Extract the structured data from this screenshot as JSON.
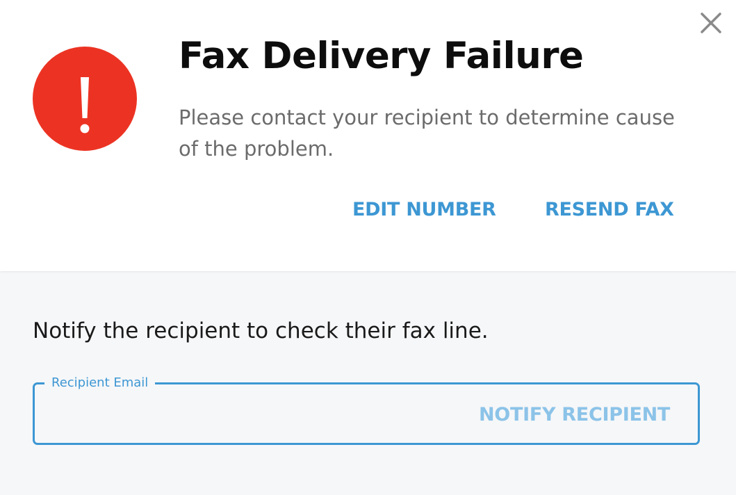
{
  "dialog": {
    "title": "Fax Delivery Failure",
    "message": "Please contact your recipient to determine cause of the problem.",
    "icon": "alert-exclamation-icon",
    "close_icon": "close-icon",
    "actions": {
      "edit_label": "EDIT NUMBER",
      "resend_label": "RESEND FAX"
    }
  },
  "notify": {
    "text": "Notify the recipient to check their fax line.",
    "field_label": "Recipient Email",
    "field_value": "",
    "button_label": "NOTIFY RECIPIENT"
  },
  "colors": {
    "alert_red": "#ec3323",
    "accent_blue": "#3d97d3",
    "disabled_blue": "#8cc3e8",
    "panel_bg": "#f6f7f9"
  }
}
